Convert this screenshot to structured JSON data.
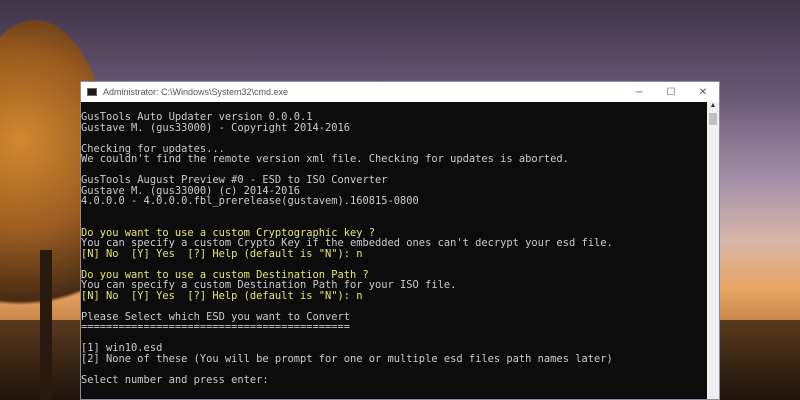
{
  "window": {
    "title": "Administrator: C:\\Windows\\System32\\cmd.exe",
    "minimize": "─",
    "maximize": "☐",
    "close": "✕"
  },
  "console": {
    "lines": [
      {
        "text": "GusTools Auto Updater version 0.0.0.1",
        "style": "w"
      },
      {
        "text": "Gustave M. (gus33000) - Copyright 2014-2016",
        "style": "w"
      },
      {
        "text": "",
        "style": "w"
      },
      {
        "text": "Checking for updates...",
        "style": "w"
      },
      {
        "text": "We couldn't find the remote version xml file. Checking for updates is aborted.",
        "style": "w"
      },
      {
        "text": "",
        "style": "w"
      },
      {
        "text": "GusTools August Preview #0 - ESD to ISO Converter",
        "style": "w"
      },
      {
        "text": "Gustave M. (gus33000) (c) 2014-2016",
        "style": "w"
      },
      {
        "text": "4.0.0.0 - 4.0.0.0.fbl_prerelease(gustavem).160815-0800",
        "style": "w"
      },
      {
        "text": "",
        "style": "w"
      },
      {
        "text": "",
        "style": "w"
      },
      {
        "text": "Do you want to use a custom Cryptographic key ?",
        "style": "y"
      },
      {
        "text": "You can specify a custom Crypto Key if the embedded ones can't decrypt your esd file.",
        "style": "w"
      },
      {
        "text": "[N] No  [Y] Yes  [?] Help (default is \"N\"): n",
        "style": "y"
      },
      {
        "text": "",
        "style": "w"
      },
      {
        "text": "Do you want to use a custom Destination Path ?",
        "style": "y"
      },
      {
        "text": "You can specify a custom Destination Path for your ISO file.",
        "style": "w"
      },
      {
        "text": "[N] No  [Y] Yes  [?] Help (default is \"N\"): n",
        "style": "y"
      },
      {
        "text": "",
        "style": "w"
      },
      {
        "text": "Please Select which ESD you want to Convert",
        "style": "w"
      },
      {
        "text": "===========================================",
        "style": "w"
      },
      {
        "text": "",
        "style": "w"
      },
      {
        "text": "[1] win10.esd",
        "style": "w"
      },
      {
        "text": "[2] None of these (You will be prompt for one or multiple esd files path names later)",
        "style": "w"
      },
      {
        "text": "",
        "style": "w"
      },
      {
        "text": "Select number and press enter:",
        "style": "w"
      }
    ]
  },
  "scrollbar": {
    "up_arrow": "▲"
  }
}
